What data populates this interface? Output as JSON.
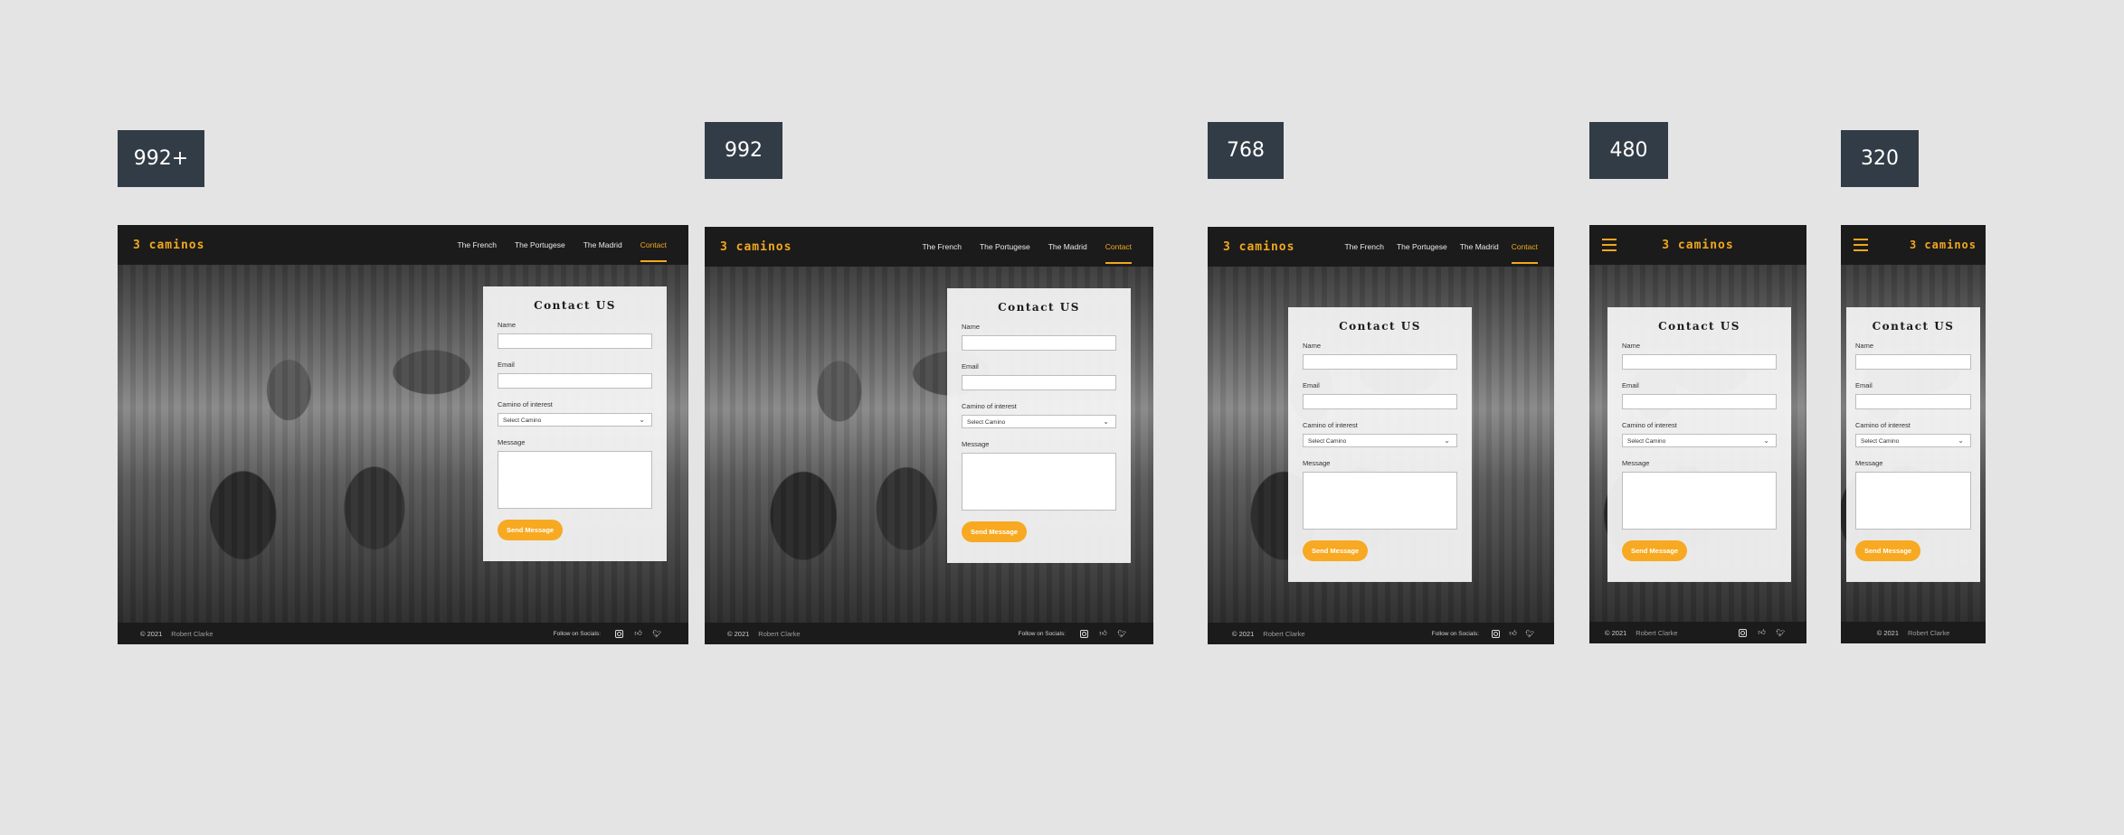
{
  "badges": [
    "992+",
    "992",
    "768",
    "480",
    "320"
  ],
  "brand": {
    "logo": "3 caminos",
    "accent": "#f2a81d"
  },
  "nav": {
    "links": [
      "The French",
      "The Portugese",
      "The Madrid",
      "Contact"
    ],
    "active": "Contact"
  },
  "form": {
    "title": "Contact US",
    "name_label": "Name",
    "email_label": "Email",
    "camino_label": "Camino of interest",
    "select_value": "Select Camino",
    "message_label": "Message",
    "submit_label": "Send Message"
  },
  "footer": {
    "copyright": "© 2021",
    "author": "Robert Clarke",
    "follow": "Follow on Socials:",
    "icons": [
      "instagram-icon",
      "thumbs-up-icon",
      "twitter-icon"
    ]
  }
}
